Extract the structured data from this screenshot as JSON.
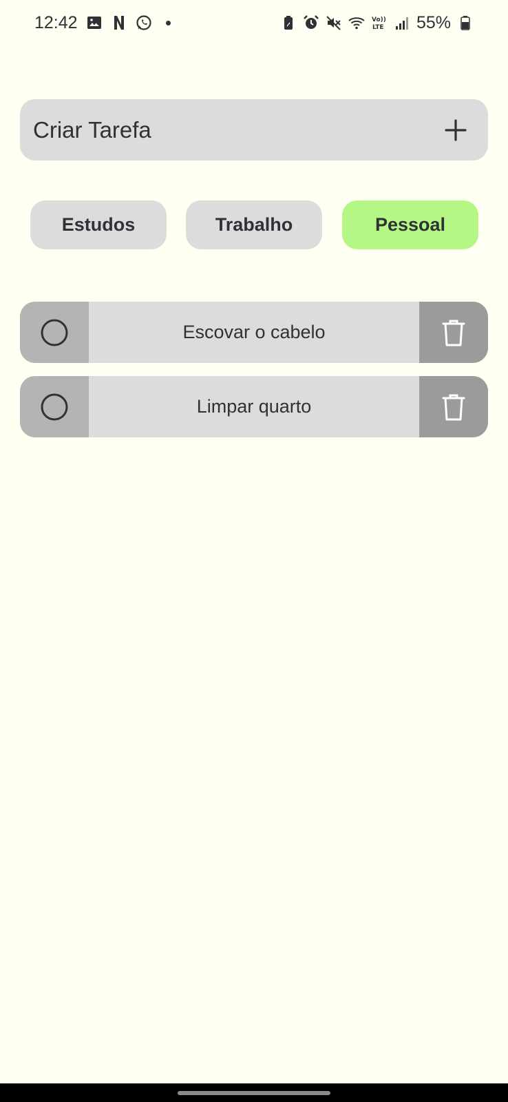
{
  "status_bar": {
    "time": "12:42",
    "battery": "55%",
    "left_icons": [
      "image-icon",
      "netflix-icon",
      "whatsapp-icon",
      "notification-dot"
    ],
    "right_icons": [
      "battery-saver-icon",
      "alarm-icon",
      "mute-icon",
      "wifi-icon",
      "volte-icon",
      "signal-icon",
      "battery-icon"
    ],
    "volte_label": "Vo)) LTE"
  },
  "create_task": {
    "label": "Criar Tarefa",
    "icon": "plus-icon"
  },
  "categories": [
    {
      "label": "Estudos",
      "active": false
    },
    {
      "label": "Trabalho",
      "active": false
    },
    {
      "label": "Pessoal",
      "active": true
    }
  ],
  "tasks": [
    {
      "label": "Escovar o cabelo",
      "completed": false
    },
    {
      "label": "Limpar quarto",
      "completed": false
    }
  ],
  "colors": {
    "background": "#FFFFF2",
    "card": "#DCDCDC",
    "active_category": "#B5F784",
    "check_area": "#B4B4B4",
    "delete_area": "#9B9B9B",
    "text": "#2f3137"
  }
}
